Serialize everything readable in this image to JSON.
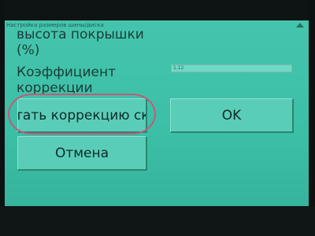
{
  "window": {
    "title": "Настройка размеров шины/диска"
  },
  "form": {
    "tire_height_label": "высота покрышки",
    "tire_height_unit": "(%)",
    "coefficient_label_line1": "Коэффициент",
    "coefficient_label_line2": "коррекции",
    "coefficient_value": "1.12"
  },
  "buttons": {
    "apply_label": "тать коррекцию ско",
    "ok_label": "OK",
    "cancel_label": "Отмена"
  },
  "colors": {
    "screen_bg": "#3cbfa7",
    "button_bg": "#5acdb9",
    "annotation_circle": "#c45a7a"
  }
}
